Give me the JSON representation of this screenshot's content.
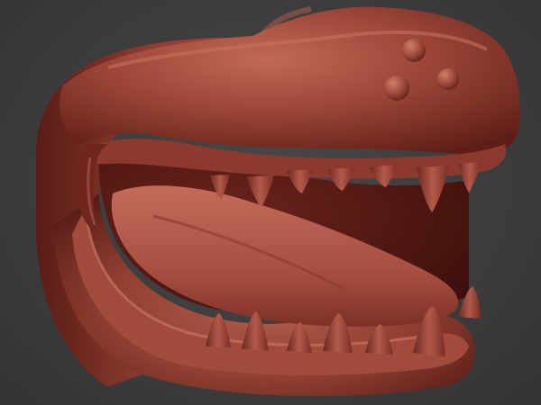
{
  "viewport": {
    "background": "#3d3d3d",
    "subject": "crocodile-head-sculpt"
  },
  "material": {
    "base": "#9a4437",
    "shadow": "#4a1712",
    "highlight": "#c9725f",
    "mouth_interior": "#7a2d23",
    "tongue": "#b3574a",
    "teeth": "#a24a3c"
  }
}
